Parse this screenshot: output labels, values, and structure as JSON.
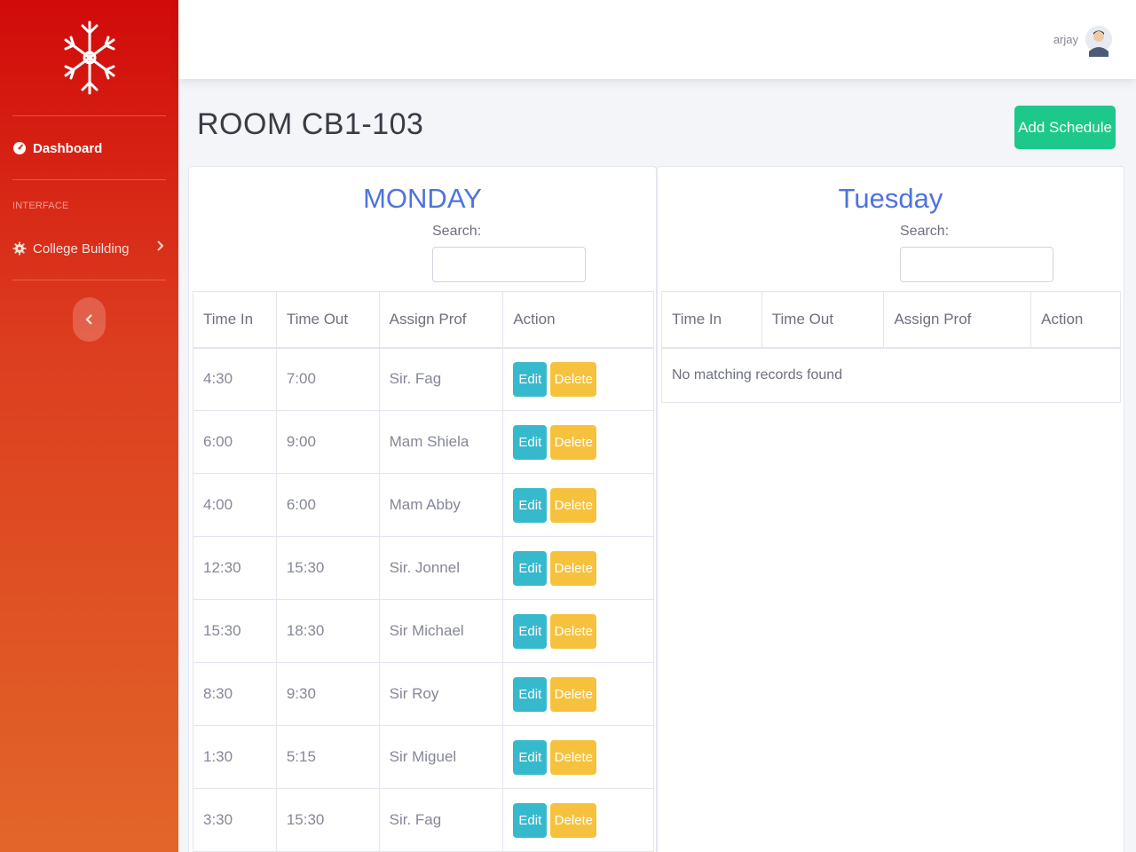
{
  "sidebar": {
    "nav": [
      {
        "label": "Dashboard",
        "icon": "tachometer-icon"
      },
      {
        "heading": "INTERFACE"
      },
      {
        "label": "College Building",
        "icon": "gear-icon"
      }
    ]
  },
  "topbar": {
    "username": "arjay"
  },
  "page": {
    "title": "ROOM CB1-103",
    "add_button": "Add Schedule"
  },
  "days": [
    {
      "title": "MONDAY",
      "search_label": "Search:",
      "columns": [
        "Time In",
        "Time Out",
        "Assign Prof",
        "Action"
      ],
      "rows": [
        {
          "time_in": "4:30",
          "time_out": "7:00",
          "prof": "Sir. Fag"
        },
        {
          "time_in": "6:00",
          "time_out": "9:00",
          "prof": "Mam Shiela"
        },
        {
          "time_in": "4:00",
          "time_out": "6:00",
          "prof": "Mam Abby"
        },
        {
          "time_in": "12:30",
          "time_out": "15:30",
          "prof": "Sir. Jonnel"
        },
        {
          "time_in": "15:30",
          "time_out": "18:30",
          "prof": "Sir Michael"
        },
        {
          "time_in": "8:30",
          "time_out": "9:30",
          "prof": "Sir Roy"
        },
        {
          "time_in": "1:30",
          "time_out": "5:15",
          "prof": "Sir Miguel"
        },
        {
          "time_in": "3:30",
          "time_out": "15:30",
          "prof": "Sir. Fag"
        }
      ],
      "edit_label": "Edit",
      "delete_label": "Delete"
    },
    {
      "title": "Tuesday",
      "search_label": "Search:",
      "columns": [
        "Time In",
        "Time Out",
        "Assign Prof",
        "Action"
      ],
      "empty_text": "No matching records found"
    }
  ],
  "colors": {
    "primary": "#4e73df",
    "success": "#1cc88a",
    "info": "#36b9cc",
    "warning": "#f6c23e",
    "sidebar_top": "#d10a0a",
    "sidebar_bottom": "#e26629"
  }
}
